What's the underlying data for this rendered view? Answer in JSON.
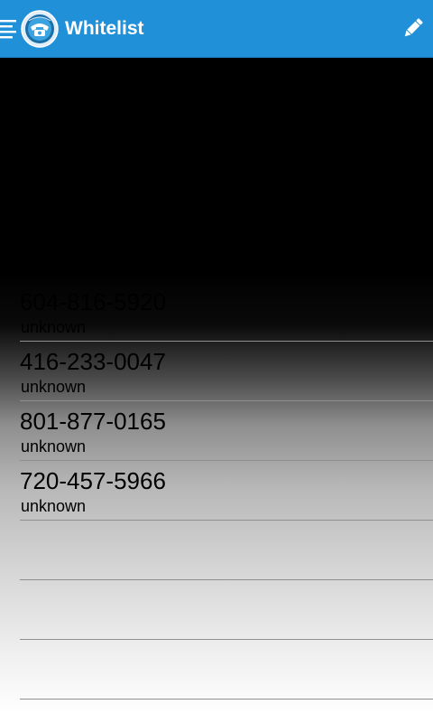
{
  "app_bar": {
    "title": "Whitelist",
    "menu_icon": "hamburger-menu-icon",
    "logo_icon": "telephone-logo-icon",
    "edit_icon": "pencil-icon",
    "background_color": "#2090d8"
  },
  "whitelist": {
    "items": [
      {
        "number": "604-816-5920",
        "name": "unknown"
      },
      {
        "number": "416-233-0047",
        "name": "unknown"
      },
      {
        "number": "801-877-0165",
        "name": "unknown"
      },
      {
        "number": "720-457-5966",
        "name": "unknown"
      },
      {
        "number": "",
        "name": ""
      },
      {
        "number": "",
        "name": ""
      },
      {
        "number": "",
        "name": ""
      }
    ]
  }
}
